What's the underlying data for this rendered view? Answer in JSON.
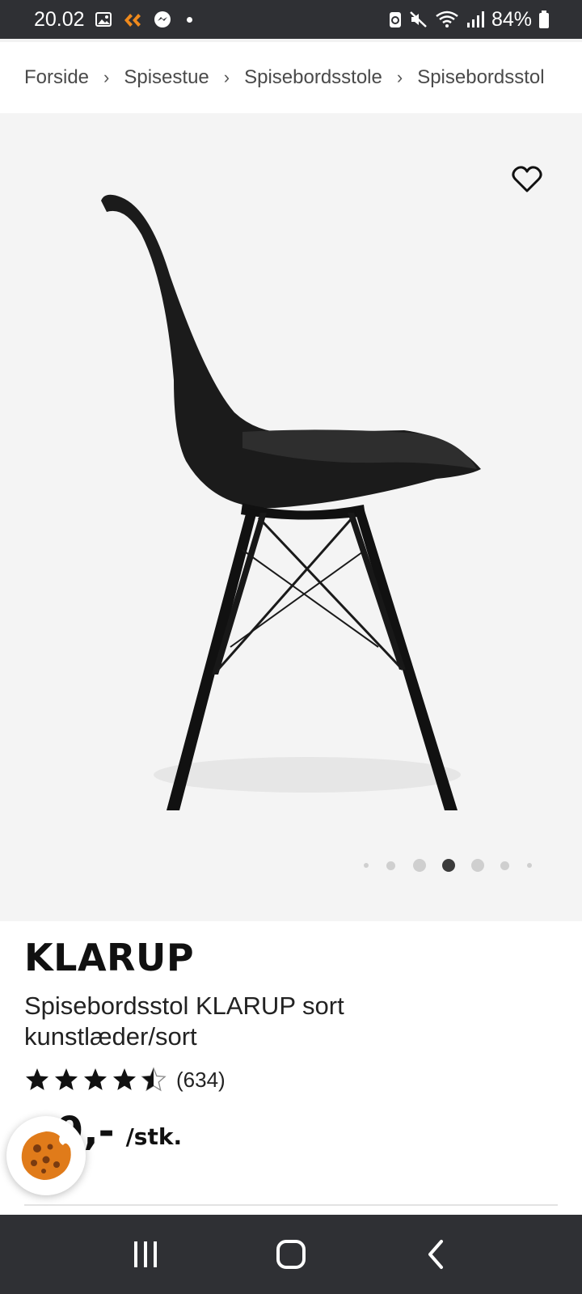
{
  "status_bar": {
    "time": "20.02",
    "battery": "84%",
    "icons": [
      "gallery-icon",
      "app-icon",
      "messenger-icon",
      "dot-icon",
      "battery-saver-icon",
      "mute-icon",
      "wifi-icon",
      "signal-icon",
      "battery-icon"
    ]
  },
  "breadcrumb": {
    "items": [
      "Forside",
      "Spisestue",
      "Spisebordsstole",
      "Spisebordsstol"
    ]
  },
  "gallery": {
    "image_subject": "chair-image",
    "image_count": 7,
    "active_index": 3
  },
  "product": {
    "brand": "KLARUP",
    "description": "Spisebordsstol KLARUP sort kunstlæder/sort",
    "rating": 4.5,
    "review_count": "(634)",
    "price": "9,-",
    "unit": "/stk."
  },
  "colors": {
    "system_bar": "#2f3034",
    "gallery_bg": "#f4f4f4",
    "cookie": "#e07b1a",
    "text": "#111111"
  }
}
